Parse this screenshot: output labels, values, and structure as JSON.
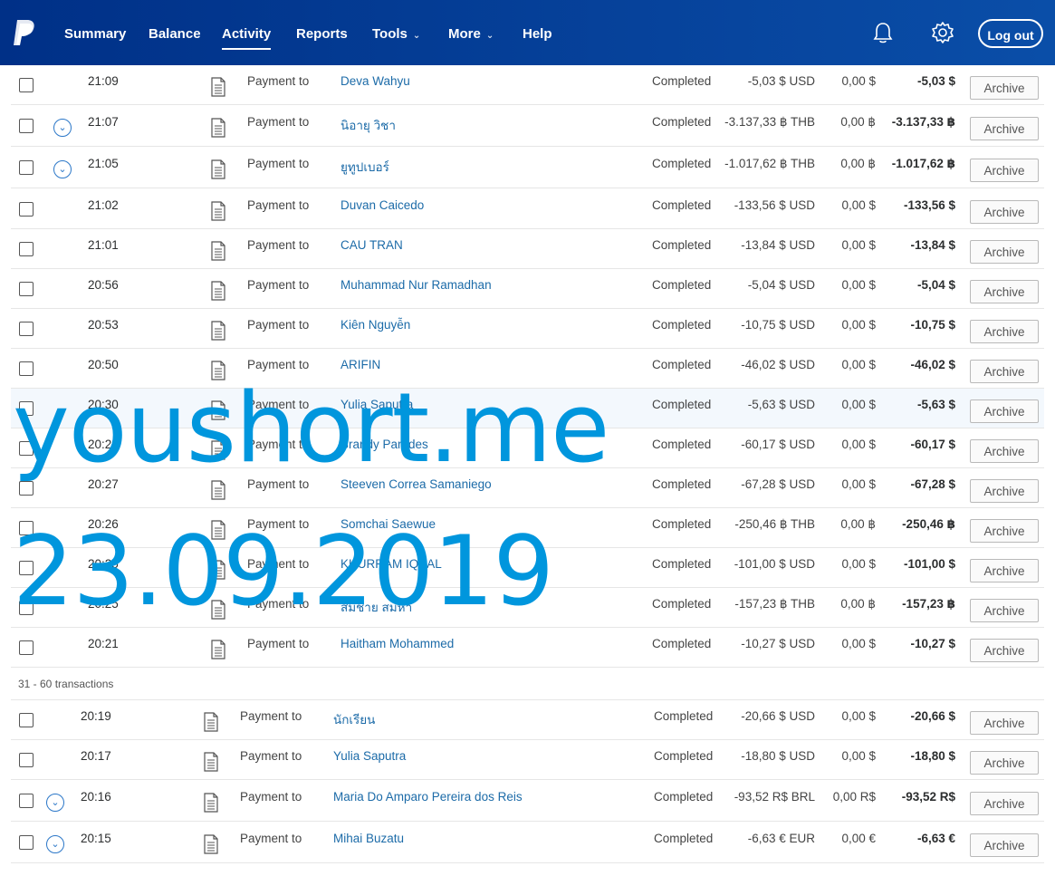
{
  "nav": {
    "items": [
      {
        "label": "Summary"
      },
      {
        "label": "Balance"
      },
      {
        "label": "Activity"
      },
      {
        "label": "Reports"
      },
      {
        "label": "Tools"
      },
      {
        "label": "More"
      },
      {
        "label": "Help"
      }
    ],
    "logout_label": "Log out",
    "icons": [
      "paypal-logo",
      "bell-icon",
      "gear-icon",
      "chevron-down-icon"
    ]
  },
  "colors": {
    "nav": "#003087",
    "link": "#1c6ba8",
    "watermark": "#0096dd"
  },
  "transactions": [
    {
      "time": "21:09",
      "desc": "Payment to",
      "name": "Deva Wahyu",
      "status": "Completed",
      "gross": "-5,03 $ USD",
      "fee": "0,00 $",
      "net": "-5,03 $",
      "action": "Archive",
      "expand": false
    },
    {
      "time": "21:07",
      "desc": "Payment to",
      "name": "นิอายุ วิชา",
      "status": "Completed",
      "gross": "-3.137,33 ฿ THB",
      "fee": "0,00 ฿",
      "net": "-3.137,33 ฿",
      "action": "Archive",
      "expand": true
    },
    {
      "time": "21:05",
      "desc": "Payment to",
      "name": "ยูทูปเบอร์",
      "status": "Completed",
      "gross": "-1.017,62 ฿ THB",
      "fee": "0,00 ฿",
      "net": "-1.017,62 ฿",
      "action": "Archive",
      "expand": true
    },
    {
      "time": "21:02",
      "desc": "Payment to",
      "name": "Duvan Caicedo",
      "status": "Completed",
      "gross": "-133,56 $ USD",
      "fee": "0,00 $",
      "net": "-133,56 $",
      "action": "Archive",
      "expand": false
    },
    {
      "time": "21:01",
      "desc": "Payment to",
      "name": "CAU TRAN",
      "status": "Completed",
      "gross": "-13,84 $ USD",
      "fee": "0,00 $",
      "net": "-13,84 $",
      "action": "Archive",
      "expand": false
    },
    {
      "time": "20:56",
      "desc": "Payment to",
      "name": "Muhammad Nur Ramadhan",
      "status": "Completed",
      "gross": "-5,04 $ USD",
      "fee": "0,00 $",
      "net": "-5,04 $",
      "action": "Archive",
      "expand": false
    },
    {
      "time": "20:53",
      "desc": "Payment to",
      "name": "Kiên Nguyễn",
      "status": "Completed",
      "gross": "-10,75 $ USD",
      "fee": "0,00 $",
      "net": "-10,75 $",
      "action": "Archive",
      "expand": false
    },
    {
      "time": "20:50",
      "desc": "Payment to",
      "name": "ARIFIN",
      "status": "Completed",
      "gross": "-46,02 $ USD",
      "fee": "0,00 $",
      "net": "-46,02 $",
      "action": "Archive",
      "expand": false
    },
    {
      "time": "20:30",
      "desc": "Payment to",
      "name": "Yulia Saputra",
      "status": "Completed",
      "gross": "-5,63 $ USD",
      "fee": "0,00 $",
      "net": "-5,63 $",
      "action": "Archive",
      "expand": false
    },
    {
      "time": "20:28",
      "desc": "Payment to",
      "name": "Brandy Paredes",
      "status": "Completed",
      "gross": "-60,17 $ USD",
      "fee": "0,00 $",
      "net": "-60,17 $",
      "action": "Archive",
      "expand": false
    },
    {
      "time": "20:27",
      "desc": "Payment to",
      "name": "Steeven Correa Samaniego",
      "status": "Completed",
      "gross": "-67,28 $ USD",
      "fee": "0,00 $",
      "net": "-67,28 $",
      "action": "Archive",
      "expand": false
    },
    {
      "time": "20:26",
      "desc": "Payment to",
      "name": "Somchai Saewue",
      "status": "Completed",
      "gross": "-250,46 ฿ THB",
      "fee": "0,00 ฿",
      "net": "-250,46 ฿",
      "action": "Archive",
      "expand": false
    },
    {
      "time": "20:25",
      "desc": "Payment to",
      "name": "KHURRAM IQBAL",
      "status": "Completed",
      "gross": "-101,00 $ USD",
      "fee": "0,00 $",
      "net": "-101,00 $",
      "action": "Archive",
      "expand": false
    },
    {
      "time": "20:25",
      "desc": "Payment to",
      "name": "สมชาย สมหา",
      "status": "Completed",
      "gross": "-157,23 ฿ THB",
      "fee": "0,00 ฿",
      "net": "-157,23 ฿",
      "action": "Archive",
      "expand": false
    },
    {
      "time": "20:21",
      "desc": "Payment to",
      "name": "Haitham Mohammed",
      "status": "Completed",
      "gross": "-10,27 $ USD",
      "fee": "0,00 $",
      "net": "-10,27 $",
      "action": "Archive",
      "expand": false
    }
  ],
  "page_separator": "31 - 60 transactions",
  "transactions2": [
    {
      "time": "20:19",
      "desc": "Payment to",
      "name": "นักเรียน",
      "status": "Completed",
      "gross": "-20,66 $ USD",
      "fee": "0,00 $",
      "net": "-20,66 $",
      "action": "Archive",
      "expand": false
    },
    {
      "time": "20:17",
      "desc": "Payment to",
      "name": "Yulia Saputra",
      "status": "Completed",
      "gross": "-18,80 $ USD",
      "fee": "0,00 $",
      "net": "-18,80 $",
      "action": "Archive",
      "expand": false
    },
    {
      "time": "20:16",
      "desc": "Payment to",
      "name": "Maria Do Amparo Pereira dos Reis",
      "status": "Completed",
      "gross": "-93,52 R$ BRL",
      "fee": "0,00 R$",
      "net": "-93,52 R$",
      "action": "Archive",
      "expand": true
    },
    {
      "time": "20:15",
      "desc": "Payment to",
      "name": "Mihai Buzatu",
      "status": "Completed",
      "gross": "-6,63 € EUR",
      "fee": "0,00 €",
      "net": "-6,63 €",
      "action": "Archive",
      "expand": true
    }
  ],
  "watermark": {
    "line1": "youshort.me",
    "line2": "23.09.2019"
  }
}
